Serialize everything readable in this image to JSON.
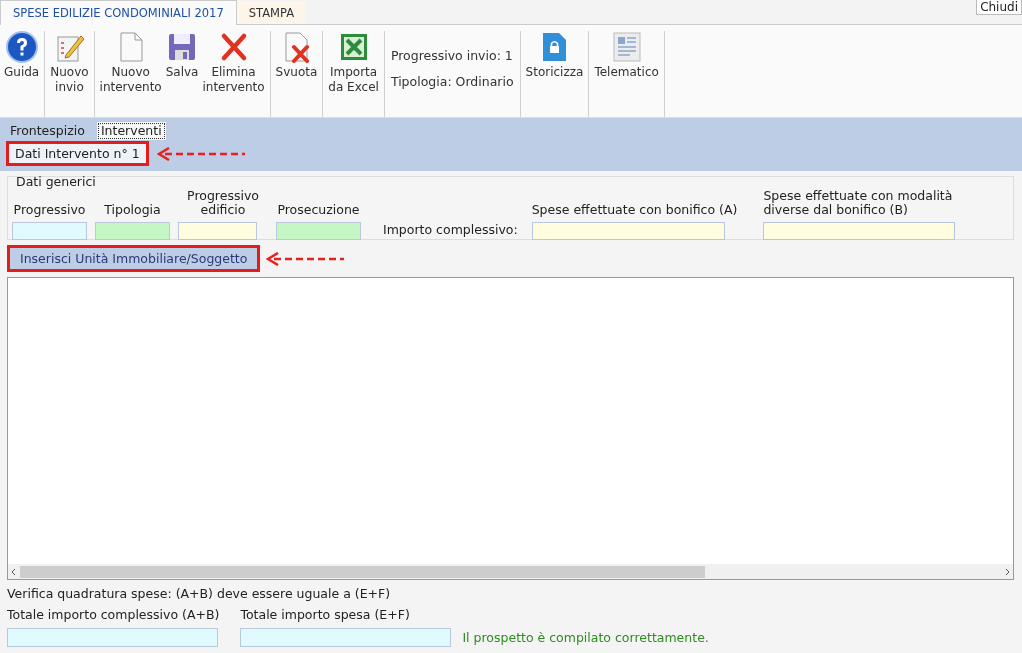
{
  "tabs": [
    {
      "label": "SPESE EDILIZIE CONDOMINIALI 2017",
      "selected": true
    },
    {
      "label": "STAMPA",
      "selected": false
    }
  ],
  "tooltip": "Chiudi",
  "toolbar": [
    {
      "kind": "buttons",
      "buttons": [
        "Guida"
      ]
    },
    {
      "kind": "buttons",
      "buttons": [
        "Nuovo\ninvio"
      ]
    },
    {
      "kind": "buttons",
      "buttons": [
        "Nuovo\nintervento",
        "Salva",
        "Elimina\nintervento"
      ]
    },
    {
      "kind": "buttons",
      "buttons": [
        "Svuota"
      ]
    },
    {
      "kind": "buttons",
      "buttons": [
        "Importa\nda Excel"
      ]
    },
    {
      "kind": "info",
      "lines": [
        "Progressivo invio: 1",
        "Tipologia: Ordinario"
      ]
    },
    {
      "kind": "buttons",
      "buttons": [
        "Storicizza"
      ]
    },
    {
      "kind": "buttons",
      "buttons": [
        "Telematico"
      ]
    }
  ],
  "sub_tabs": [
    {
      "label": "Frontespizio",
      "selected": false
    },
    {
      "label": "Interventi",
      "selected": true
    }
  ],
  "section_title": "Dati Intervento n° 1",
  "group": {
    "title": "Dati generici",
    "items": [
      {
        "kind": "field",
        "label": "Progressivo",
        "color": "#e0fbff"
      },
      {
        "kind": "field",
        "label": "Tipologia",
        "color": "#c4f7c4"
      },
      {
        "kind": "field",
        "label": "Progressivo edificio",
        "color": "#fffde0"
      },
      {
        "kind": "field",
        "label": "Prosecuzione",
        "color": "#c4f7c4"
      },
      {
        "kind": "label",
        "label": "Importo complessivo:"
      },
      {
        "kind": "field",
        "label": "Spese effettuate con bonifico (A)",
        "color": "#fffde0"
      },
      {
        "kind": "field",
        "label": "Spese effettuate con modalità diverse dal bonifico (B)",
        "color": "#fffde0"
      }
    ]
  },
  "insert_button": "Inserisci Unità Immobiliare/Soggetto",
  "footer": {
    "check": "Verifica quadratura spese: (A+B) deve essere uguale a (E+F)",
    "totals": [
      {
        "label": "Totale importo complessivo (A+B)",
        "color": "#e0fbff"
      },
      {
        "label": "Totale importo spesa (E+F)",
        "color": "#e0fbff"
      }
    ],
    "status": "Il prospetto è compilato correttamente."
  }
}
